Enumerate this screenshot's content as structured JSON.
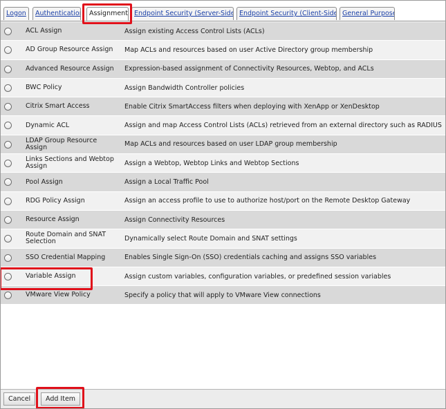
{
  "tabs": [
    {
      "label": "Logon",
      "active": false
    },
    {
      "label": "Authentication",
      "active": false
    },
    {
      "label": "Assignment",
      "active": true
    },
    {
      "label": "Endpoint Security (Server-Side)",
      "active": false
    },
    {
      "label": "Endpoint Security (Client-Side)",
      "active": false
    },
    {
      "label": "General Purpose",
      "active": false
    }
  ],
  "items": [
    {
      "name": "ACL Assign",
      "description": "Assign existing Access Control Lists (ACLs)"
    },
    {
      "name": "AD Group Resource Assign",
      "description": "Map ACLs and resources based on user Active Directory group membership"
    },
    {
      "name": "Advanced Resource Assign",
      "description": "Expression-based assignment of Connectivity Resources, Webtop, and ACLs"
    },
    {
      "name": "BWC Policy",
      "description": "Assign Bandwidth Controller policies"
    },
    {
      "name": "Citrix Smart Access",
      "description": "Enable Citrix SmartAccess filters when deploying with XenApp or XenDesktop"
    },
    {
      "name": "Dynamic ACL",
      "description": "Assign and map Access Control Lists (ACLs) retrieved from an external directory such as RADIUS or LDAP"
    },
    {
      "name": "LDAP Group Resource Assign",
      "description": "Map ACLs and resources based on user LDAP group membership"
    },
    {
      "name": "Links Sections and Webtop Assign",
      "description": "Assign a Webtop, Webtop Links and Webtop Sections"
    },
    {
      "name": "Pool Assign",
      "description": "Assign a Local Traffic Pool"
    },
    {
      "name": "RDG Policy Assign",
      "description": "Assign an access profile to use to authorize host/port on the Remote Desktop Gateway"
    },
    {
      "name": "Resource Assign",
      "description": "Assign Connectivity Resources"
    },
    {
      "name": "Route Domain and SNAT Selection",
      "description": "Dynamically select Route Domain and SNAT settings"
    },
    {
      "name": "SSO Credential Mapping",
      "description": "Enables Single Sign-On (SSO) credentials caching and assigns SSO variables"
    },
    {
      "name": "Variable Assign",
      "description": "Assign custom variables, configuration variables, or predefined session variables"
    },
    {
      "name": "VMware View Policy",
      "description": "Specify a policy that will apply to VMware View connections"
    }
  ],
  "footer": {
    "cancel_label": "Cancel",
    "add_label": "Add Item"
  }
}
